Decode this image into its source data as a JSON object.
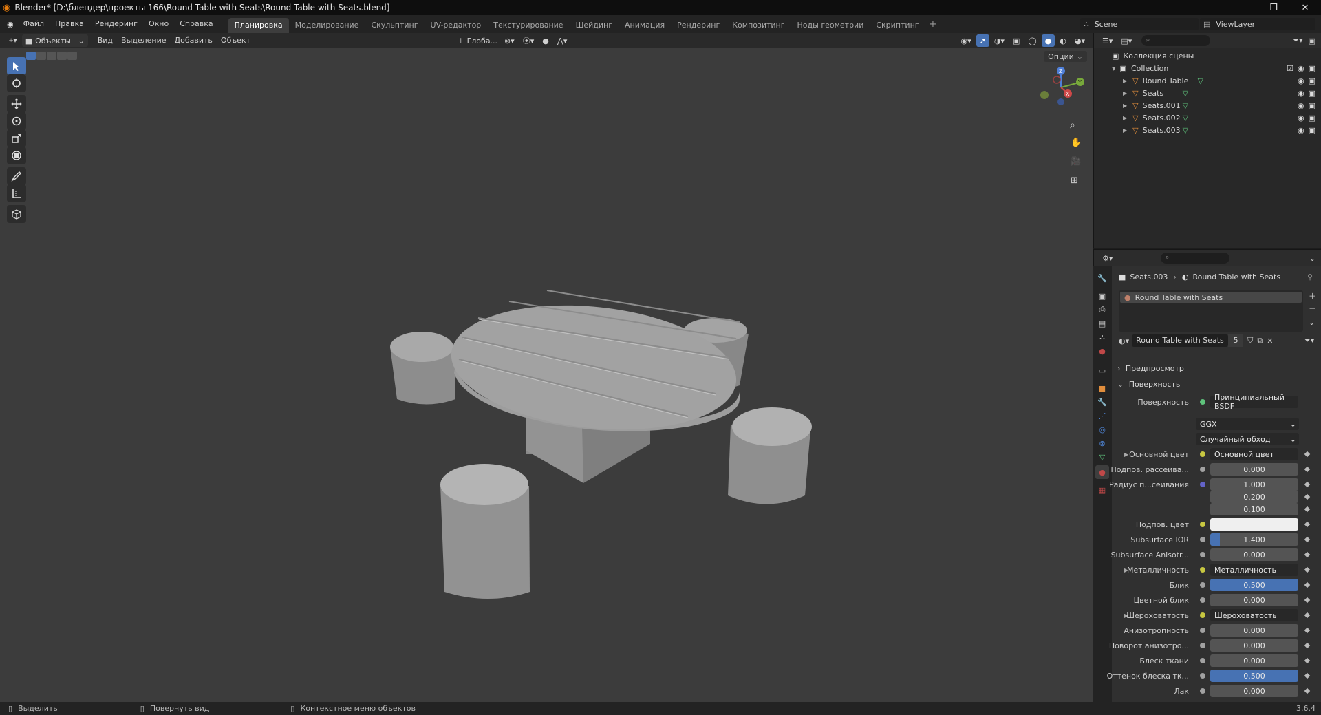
{
  "window": {
    "title": "Blender* [D:\\блендер\\проекты 166\\Round Table with Seats\\Round Table with Seats.blend]",
    "minimize": "—",
    "maximize": "❐",
    "close": "✕"
  },
  "menu": [
    "Файл",
    "Правка",
    "Рендеринг",
    "Окно",
    "Справка"
  ],
  "workspaces": [
    "Планировка",
    "Моделирование",
    "Скульптинг",
    "UV-редактор",
    "Текстурирование",
    "Шейдинг",
    "Анимация",
    "Рендеринг",
    "Композитинг",
    "Ноды геометрии",
    "Скриптинг"
  ],
  "workspace_add": "+",
  "scene": {
    "label": "Scene",
    "viewlayer": "ViewLayer"
  },
  "viewport_header": {
    "mode": "Объекты",
    "menus": [
      "Вид",
      "Выделение",
      "Добавить",
      "Объект"
    ],
    "orientation": "Глоба...",
    "options": "Опции"
  },
  "outliner": {
    "scene_collection": "Коллекция сцены",
    "collection": "Collection",
    "objects": [
      "Round Table",
      "Seats",
      "Seats.001",
      "Seats.002",
      "Seats.003"
    ]
  },
  "properties": {
    "breadcrumb_object": "Seats.003",
    "breadcrumb_material": "Round Table with Seats",
    "slot_name": "Round Table with Seats",
    "material_name": "Round Table with Seats",
    "users": "5",
    "preview_section": "Предпросмотр",
    "surface_section": "Поверхность",
    "surface_label": "Поверхность",
    "surface_value": "Принципиальный BSDF",
    "distribution": "GGX",
    "subsurface_method": "Случайный обход",
    "rows": [
      {
        "label": "Основной цвет",
        "value": "Основной цвет",
        "kind": "link"
      },
      {
        "label": "Подпов. рассеива...",
        "value": "0.000",
        "kind": "num"
      },
      {
        "label": "Радиус п...сеивания",
        "value": "1.000",
        "kind": "num"
      },
      {
        "label": "",
        "value": "0.200",
        "kind": "num"
      },
      {
        "label": "",
        "value": "0.100",
        "kind": "num"
      },
      {
        "label": "Подпов. цвет",
        "value": "",
        "kind": "color"
      },
      {
        "label": "Subsurface IOR",
        "value": "1.400",
        "kind": "num"
      },
      {
        "label": "Subsurface Anisotr...",
        "value": "0.000",
        "kind": "num"
      },
      {
        "label": "Металличность",
        "value": "Металличность",
        "kind": "link"
      },
      {
        "label": "Блик",
        "value": "0.500",
        "kind": "num"
      },
      {
        "label": "Цветной блик",
        "value": "0.000",
        "kind": "num"
      },
      {
        "label": "Шероховатость",
        "value": "Шероховатость",
        "kind": "link"
      },
      {
        "label": "Анизотропность",
        "value": "0.000",
        "kind": "num"
      },
      {
        "label": "Поворот анизотро...",
        "value": "0.000",
        "kind": "num"
      },
      {
        "label": "Блеск ткани",
        "value": "0.000",
        "kind": "num"
      },
      {
        "label": "Оттенок блеска тк...",
        "value": "0.500",
        "kind": "num"
      },
      {
        "label": "Лак",
        "value": "0.000",
        "kind": "num"
      }
    ]
  },
  "status": {
    "select": "Выделить",
    "rotate": "Повернуть вид",
    "context": "Контекстное меню объектов",
    "version": "3.6.4"
  },
  "colors": {
    "accent": "#4772b3",
    "object_orange": "#e08d3c",
    "mesh_green": "#5fc37c"
  }
}
